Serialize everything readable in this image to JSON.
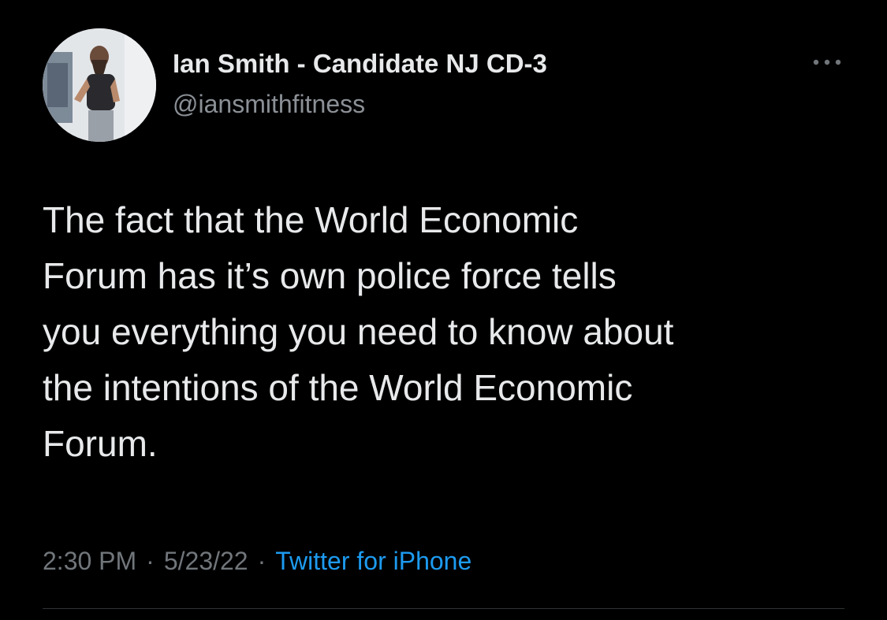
{
  "author": {
    "display_name": "Ian Smith - Candidate NJ CD-3",
    "handle": "@iansmithfitness",
    "avatar_icon": "profile-photo"
  },
  "tweet": {
    "text": "The fact that the World Economic\nForum has it’s own police force tells\nyou everything you need to know about\nthe intentions of the World Economic\nForum."
  },
  "meta": {
    "time": "2:30 PM",
    "separator": "·",
    "date": "5/23/22",
    "source": "Twitter for iPhone"
  },
  "icons": {
    "more": "more-options-icon"
  },
  "colors": {
    "background": "#000000",
    "primary_text": "#e7e9ea",
    "secondary_text": "#71767b",
    "link": "#1d9bf0"
  }
}
